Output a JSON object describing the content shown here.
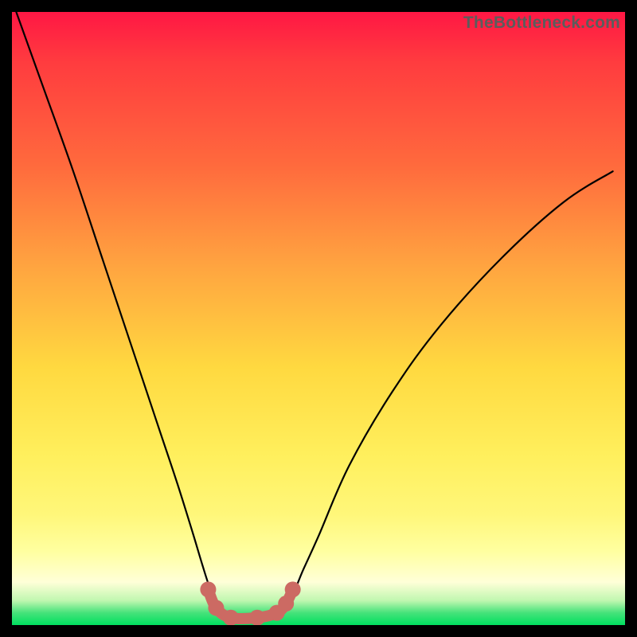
{
  "watermark": "TheBottleneck.com",
  "chart_data": {
    "type": "line",
    "title": "",
    "xlabel": "",
    "ylabel": "",
    "x_range": [
      0,
      1
    ],
    "y_range": [
      0,
      1
    ],
    "series": [
      {
        "name": "curve",
        "x": [
          0.007,
          0.05,
          0.1,
          0.15,
          0.2,
          0.24,
          0.27,
          0.295,
          0.31,
          0.323,
          0.335,
          0.35,
          0.375,
          0.4,
          0.43,
          0.455,
          0.475,
          0.5,
          0.55,
          0.62,
          0.7,
          0.8,
          0.9,
          0.98
        ],
        "y": [
          1.0,
          0.88,
          0.74,
          0.59,
          0.44,
          0.32,
          0.23,
          0.15,
          0.1,
          0.06,
          0.035,
          0.02,
          0.012,
          0.012,
          0.02,
          0.045,
          0.09,
          0.145,
          0.26,
          0.38,
          0.49,
          0.6,
          0.69,
          0.74
        ]
      }
    ],
    "markers": {
      "name": "bottom-dots",
      "x": [
        0.32,
        0.333,
        0.357,
        0.4,
        0.432,
        0.447,
        0.458
      ],
      "y": [
        0.058,
        0.028,
        0.012,
        0.012,
        0.02,
        0.035,
        0.058
      ]
    },
    "background_gradient": {
      "top": "#ff1744",
      "middle": "#ffe84a",
      "bottom": "#00e060"
    }
  }
}
